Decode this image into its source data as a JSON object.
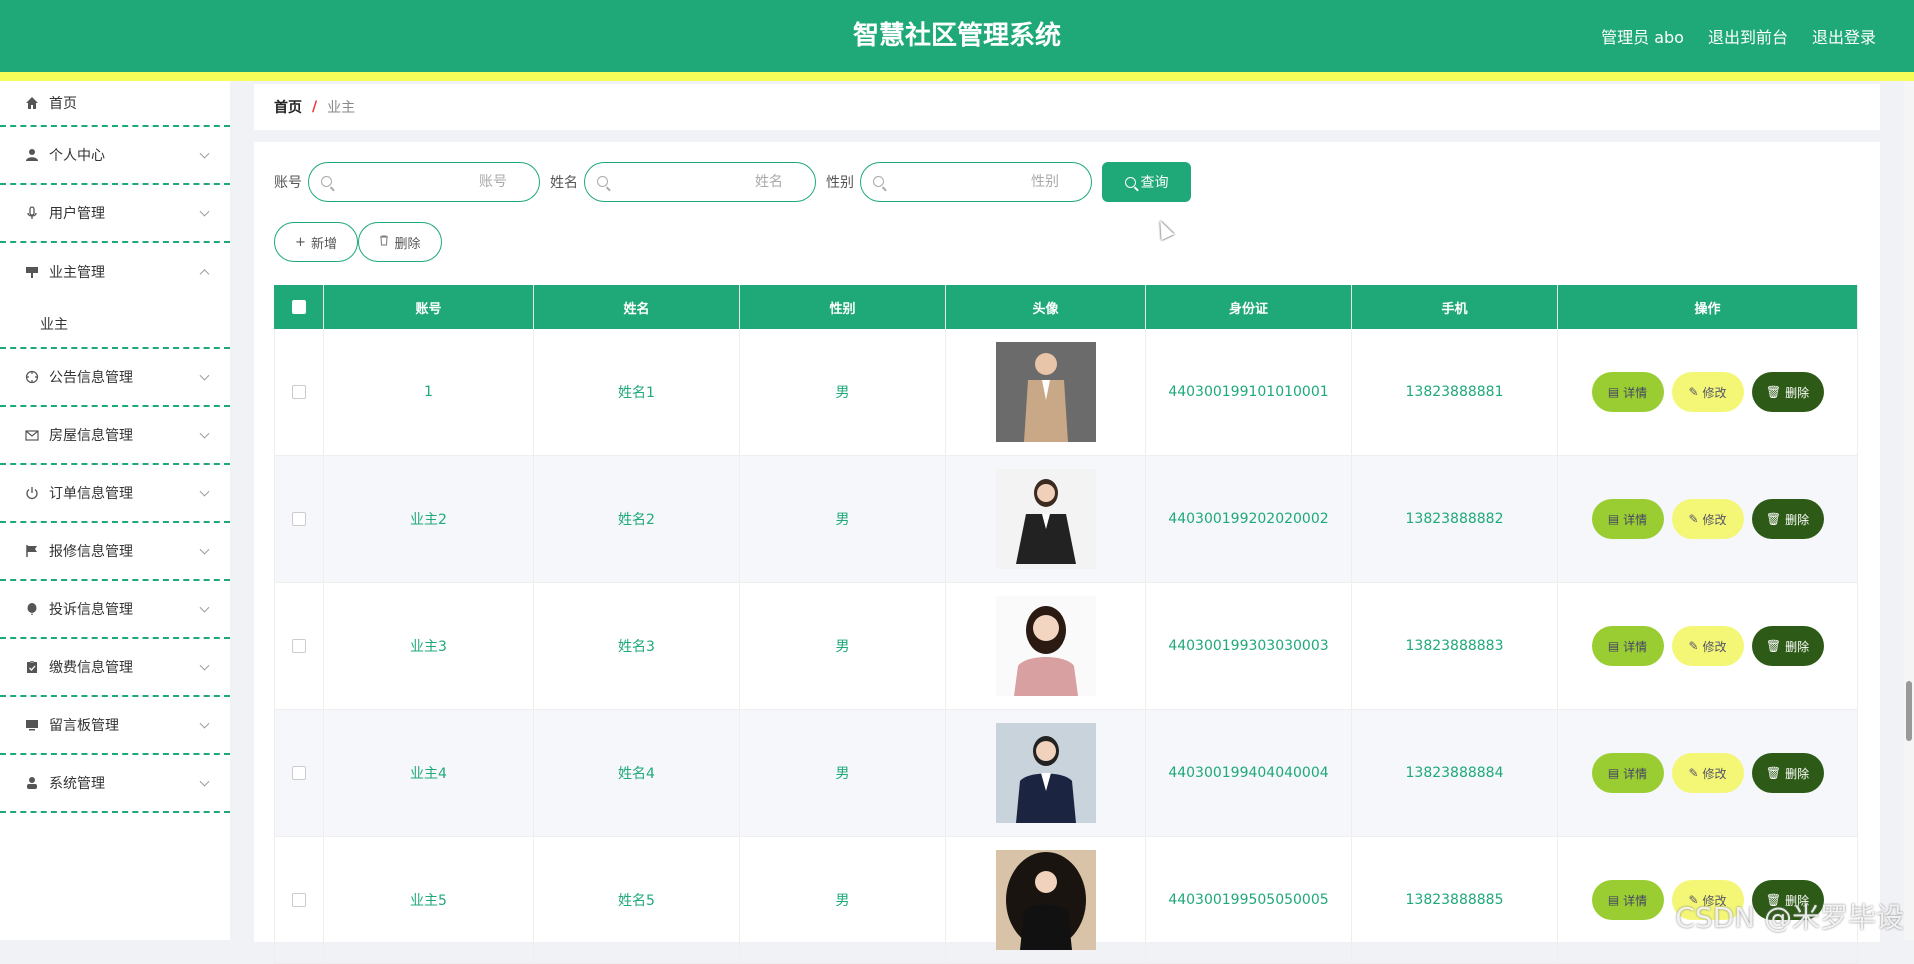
{
  "header": {
    "title": "智慧社区管理系统",
    "links": [
      "管理员 abo",
      "退出到前台",
      "退出登录"
    ]
  },
  "sidebar": {
    "items": [
      {
        "label": "首页",
        "icon": "home-icon"
      },
      {
        "label": "个人中心",
        "icon": "user-icon"
      },
      {
        "label": "用户管理",
        "icon": "microphone-icon"
      },
      {
        "label": "业主管理",
        "icon": "sign-icon",
        "expanded": true,
        "children": [
          "业主"
        ]
      },
      {
        "label": "公告信息管理",
        "icon": "target-icon"
      },
      {
        "label": "房屋信息管理",
        "icon": "mail-icon"
      },
      {
        "label": "订单信息管理",
        "icon": "power-icon"
      },
      {
        "label": "报修信息管理",
        "icon": "flag-icon"
      },
      {
        "label": "投诉信息管理",
        "icon": "balloon-icon"
      },
      {
        "label": "缴费信息管理",
        "icon": "clipboard-icon"
      },
      {
        "label": "留言板管理",
        "icon": "monitor-icon"
      },
      {
        "label": "系统管理",
        "icon": "person-icon"
      }
    ]
  },
  "breadcrumb": {
    "home": "首页",
    "separator": "/",
    "current": "业主"
  },
  "search": {
    "fields": [
      {
        "label": "账号",
        "placeholder": "账号"
      },
      {
        "label": "姓名",
        "placeholder": "姓名"
      },
      {
        "label": "性别",
        "placeholder": "性别"
      }
    ],
    "query_label": "查询"
  },
  "actions": {
    "add_label": "新增",
    "delete_label": "删除"
  },
  "table": {
    "columns": [
      "账号",
      "姓名",
      "性别",
      "头像",
      "身份证",
      "手机",
      "操作"
    ],
    "rows": [
      {
        "account": "1",
        "name": "姓名1",
        "gender": "男",
        "idcard": "440300199101010001",
        "phone": "13823888881"
      },
      {
        "account": "业主2",
        "name": "姓名2",
        "gender": "男",
        "idcard": "440300199202020002",
        "phone": "13823888882"
      },
      {
        "account": "业主3",
        "name": "姓名3",
        "gender": "男",
        "idcard": "440300199303030003",
        "phone": "13823888883"
      },
      {
        "account": "业主4",
        "name": "姓名4",
        "gender": "男",
        "idcard": "440300199404040004",
        "phone": "13823888884"
      },
      {
        "account": "业主5",
        "name": "姓名5",
        "gender": "男",
        "idcard": "440300199505050005",
        "phone": "13823888885"
      }
    ],
    "row_actions": {
      "detail": "详情",
      "edit": "修改",
      "delete": "删除"
    }
  },
  "watermark": "CSDN @米罗毕设",
  "colors": {
    "primary": "#1fa978",
    "accent_yellow": "#f6ff5a",
    "detail_btn": "#9acd32",
    "edit_btn": "#f4f776",
    "delete_btn": "#2d5a16"
  }
}
